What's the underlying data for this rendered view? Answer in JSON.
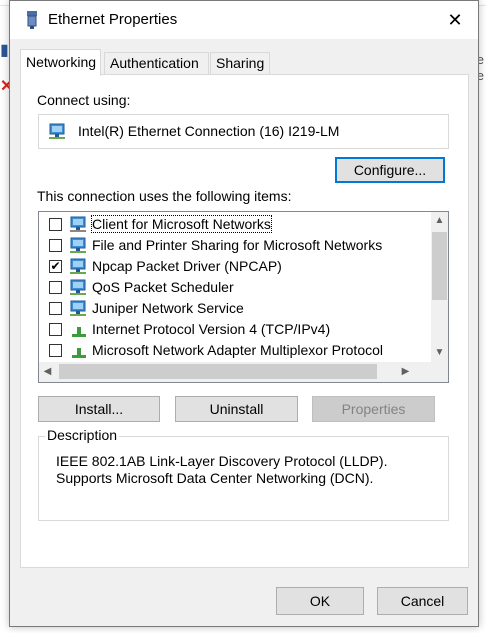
{
  "window": {
    "title": "Ethernet Properties"
  },
  "tabs": [
    {
      "label": "Networking",
      "active": true
    },
    {
      "label": "Authentication",
      "active": false
    },
    {
      "label": "Sharing",
      "active": false
    }
  ],
  "connect": {
    "label": "Connect using:",
    "adapter": "Intel(R) Ethernet Connection (16) I219-LM",
    "configure_label": "Configure..."
  },
  "items_label": "This connection uses the following items:",
  "items": [
    {
      "label": "Client for Microsoft Networks",
      "checked": false,
      "icon": "network-client-icon"
    },
    {
      "label": "File and Printer Sharing for Microsoft Networks",
      "checked": false,
      "icon": "network-service-icon"
    },
    {
      "label": "Npcap Packet Driver (NPCAP)",
      "checked": true,
      "icon": "network-service-icon"
    },
    {
      "label": "QoS Packet Scheduler",
      "checked": false,
      "icon": "network-service-icon"
    },
    {
      "label": "Juniper Network Service",
      "checked": false,
      "icon": "network-service-icon"
    },
    {
      "label": "Internet Protocol Version 4 (TCP/IPv4)",
      "checked": false,
      "icon": "protocol-icon"
    },
    {
      "label": "Microsoft Network Adapter Multiplexor Protocol",
      "checked": false,
      "icon": "protocol-icon"
    }
  ],
  "buttons": {
    "install": "Install...",
    "uninstall": "Uninstall",
    "properties": "Properties",
    "ok": "OK",
    "cancel": "Cancel"
  },
  "description": {
    "legend": "Description",
    "text": "IEEE 802.1AB Link-Layer Discovery Protocol (LLDP). Supports Microsoft Data Center Networking (DCN)."
  },
  "colors": {
    "accent": "#0078d7",
    "panel_bg": "#f0f0f0"
  }
}
